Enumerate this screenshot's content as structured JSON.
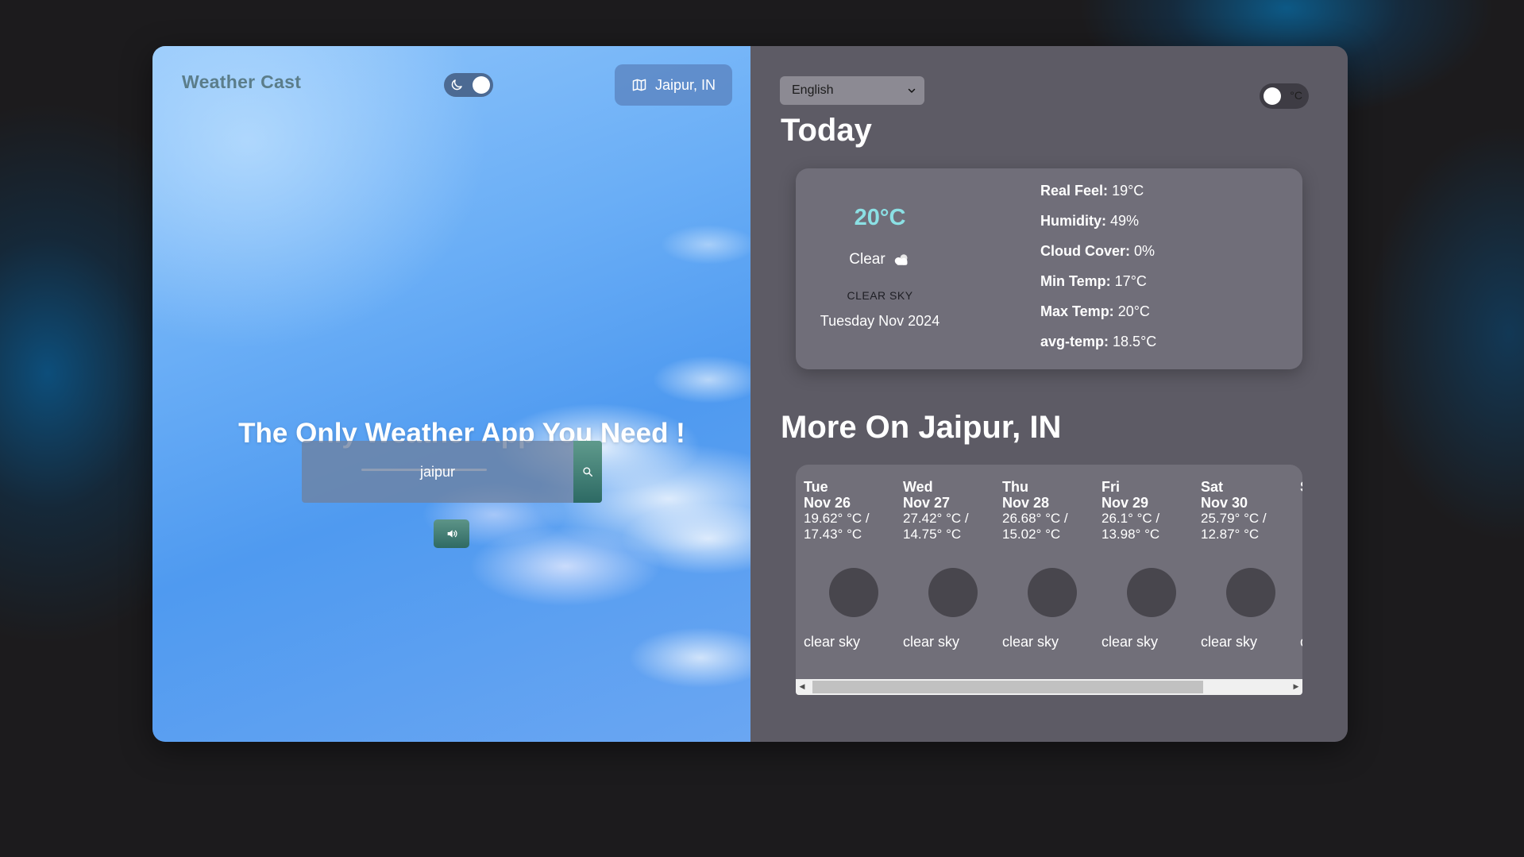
{
  "app": {
    "brand": "Weather Cast",
    "location_button": "Jaipur, IN",
    "headline": "The Only Weather App You Need !",
    "search": {
      "value": "jaipur"
    }
  },
  "settings": {
    "language": "English",
    "unit": "°C",
    "dark_mode": true
  },
  "today": {
    "heading": "Today",
    "temperature": "20°C",
    "condition": "Clear",
    "description": "CLEAR SKY",
    "date": "Tuesday Nov 2024",
    "stats": [
      {
        "label": "Real Feel:",
        "value": "19°C"
      },
      {
        "label": "Humidity:",
        "value": "49%"
      },
      {
        "label": "Cloud Cover:",
        "value": "0%"
      },
      {
        "label": "Min Temp:",
        "value": "17°C"
      },
      {
        "label": "Max Temp:",
        "value": "20°C"
      },
      {
        "label": "avg-temp:",
        "value": "18.5°C"
      }
    ]
  },
  "forecast": {
    "heading": "More On Jaipur, IN",
    "days": [
      {
        "day": "Tue",
        "date": "Nov 26",
        "temp_line1": "19.62° °C /",
        "temp_line2": "17.43° °C",
        "desc": "clear sky"
      },
      {
        "day": "Wed",
        "date": "Nov 27",
        "temp_line1": "27.42° °C /",
        "temp_line2": "14.75° °C",
        "desc": "clear sky"
      },
      {
        "day": "Thu",
        "date": "Nov 28",
        "temp_line1": "26.68° °C /",
        "temp_line2": "15.02° °C",
        "desc": "clear sky"
      },
      {
        "day": "Fri",
        "date": "Nov 29",
        "temp_line1": "26.1° °C /",
        "temp_line2": "13.98° °C",
        "desc": "clear sky"
      },
      {
        "day": "Sat",
        "date": "Nov 30",
        "temp_line1": "25.79° °C /",
        "temp_line2": "12.87° °C",
        "desc": "clear sky"
      },
      {
        "day": "S",
        "date": "",
        "temp_line1": "",
        "temp_line2": "",
        "desc": "c"
      }
    ]
  },
  "colors": {
    "accent_temp": "#8be0e4",
    "panel_right": "#5d5b65",
    "card": "#706e79",
    "button_teal": "#2d6a64"
  },
  "icons": {
    "moon": "moon-icon",
    "map": "map-icon",
    "search": "search-icon",
    "speaker": "speaker-icon",
    "cloud": "cloud-icon",
    "chevron": "chevron-down-icon"
  }
}
